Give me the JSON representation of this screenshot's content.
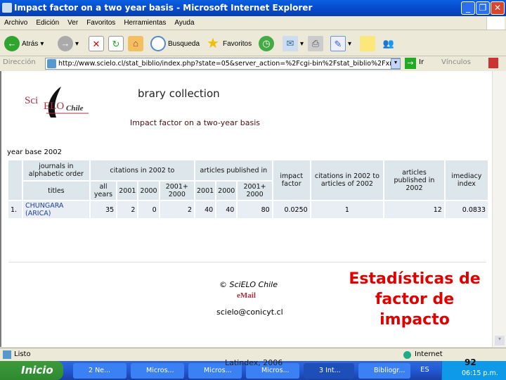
{
  "window": {
    "title": "Impact factor on a two year basis - Microsoft Internet Explorer"
  },
  "menu": [
    "Archivo",
    "Edición",
    "Ver",
    "Favoritos",
    "Herramientas",
    "Ayuda"
  ],
  "toolbar": {
    "back": "Atrás",
    "search": "Busqueda",
    "favorites": "Favoritos"
  },
  "address": {
    "label": "Dirección",
    "url": "http://www.scielo.cl/stat_biblio/index.php?state=05&server_action=%2Fcgi-bin%2Fstat_biblio%2Fxml%2Fscie",
    "go": "Ir",
    "links": "Vínculos"
  },
  "page": {
    "logo": "SciELO Chile",
    "heading": "brary collection",
    "subtitle": "Impact factor on a two-year basis",
    "year_base": "year base 2002",
    "table": {
      "h1": [
        "journals in alphabetic order",
        "citations in 2002 to",
        "articles published in",
        "impact factor",
        "citations in 2002 to articles of 2002",
        "articles published in 2002",
        "imediacy index"
      ],
      "h2": [
        "titles",
        "all years",
        "2001",
        "2000",
        "2001+ 2000",
        "2001",
        "2000",
        "2001+ 2000"
      ],
      "rows": [
        {
          "n": "1.",
          "title": "CHUNGARA (ARICA)",
          "cells": [
            "35",
            "2",
            "0",
            "2",
            "40",
            "40",
            "80",
            "0.0250",
            "1",
            "12",
            "0.0833"
          ]
        }
      ]
    },
    "copyright": "© SciELO Chile",
    "mail": "eMail",
    "email": "scielo@conicyt.cl"
  },
  "overlay": {
    "lines": [
      "Estadísticas de",
      "factor de",
      "impacto"
    ]
  },
  "status": {
    "text": "Listo",
    "zone": "Internet"
  },
  "taskbar": {
    "start": "Inicio",
    "tasks": [
      "2 Ne...",
      "Micros...",
      "Micros...",
      "Micros...",
      "3 Int...",
      "Bibliogr..."
    ],
    "lang": "ES",
    "clock": "06:15 p.m."
  },
  "footer": {
    "caption": "Latindex, 2006",
    "slide_number": "92"
  },
  "colors": {
    "accent_red": "#e00000",
    "title_blue": "#0548c8",
    "header_cell": "#dde7eb"
  }
}
